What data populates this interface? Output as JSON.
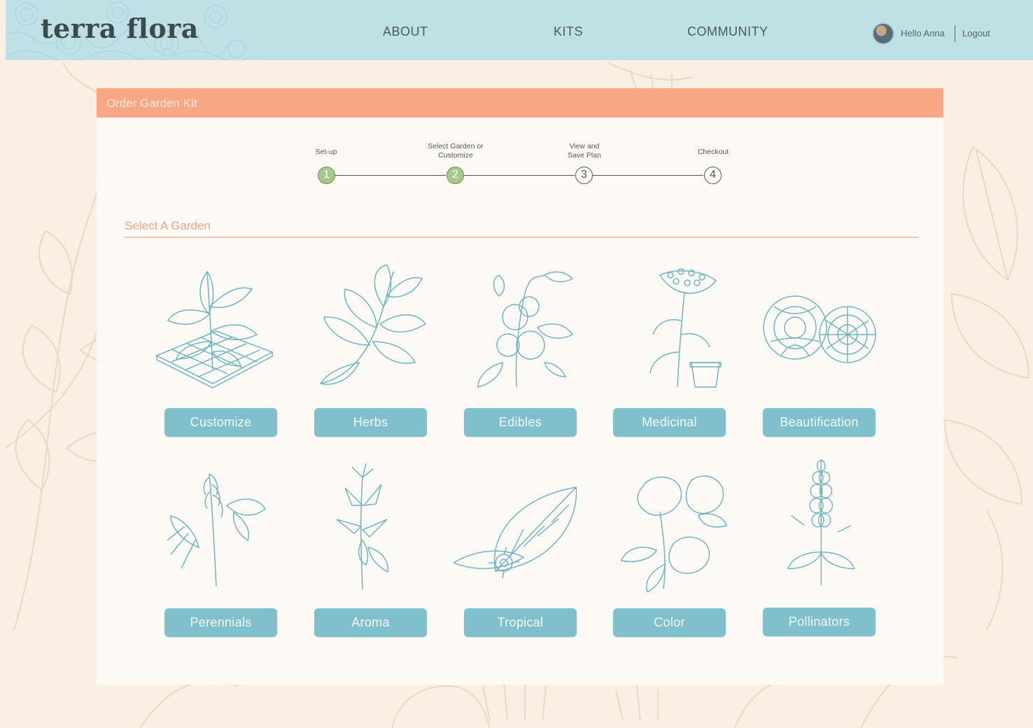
{
  "brand": {
    "logo_text": "terra flora",
    "accent": "#f8a785",
    "teal": "#80c0cd",
    "header_bg": "#bfe0e5"
  },
  "nav": {
    "links": [
      "ABOUT",
      "KITS",
      "COMMUNITY"
    ],
    "greeting": "Hello Anna",
    "logout": "Logout"
  },
  "panel": {
    "title": "Order Garden Kit",
    "steps": [
      {
        "num": "1",
        "label": "Set-up",
        "state": "done"
      },
      {
        "num": "2",
        "label": "Select Garden or Customize",
        "state": "done"
      },
      {
        "num": "3",
        "label": "View and Save Plan",
        "state": "todo"
      },
      {
        "num": "4",
        "label": "Checkout",
        "state": "todo"
      }
    ],
    "section_title": "Select A Garden"
  },
  "gardens": [
    {
      "label": "Customize",
      "icon": "leafy-plant-grid-icon"
    },
    {
      "label": "Herbs",
      "icon": "herb-sprig-icon"
    },
    {
      "label": "Edibles",
      "icon": "tomato-plant-icon"
    },
    {
      "label": "Medicinal",
      "icon": "yarrow-pot-icon"
    },
    {
      "label": "Beautification",
      "icon": "peony-flowers-icon"
    },
    {
      "label": "Perennials",
      "icon": "foxglove-plant-icon"
    },
    {
      "label": "Aroma",
      "icon": "lily-stem-icon"
    },
    {
      "label": "Tropical",
      "icon": "monstera-plumeria-icon"
    },
    {
      "label": "Color",
      "icon": "petunia-flowers-icon"
    },
    {
      "label": "Pollinators",
      "icon": "lavender-spike-icon"
    }
  ]
}
